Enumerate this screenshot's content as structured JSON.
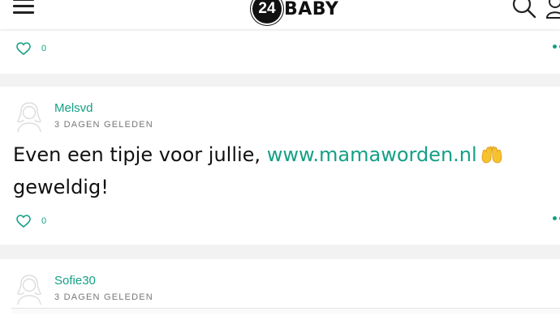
{
  "header": {
    "logo_number": "24",
    "logo_text": "BABY"
  },
  "posts": [
    {
      "likes": "0"
    },
    {
      "author": "Melsvd",
      "time": "3 DAGEN GELEDEN",
      "text_before": "Even een tipje voor jullie,",
      "link": "www.mamaworden.nl",
      "emoji": "raising-hands-emoji",
      "text_after": "geweldig!",
      "likes": "0"
    },
    {
      "author": "Sofie30",
      "time": "3 DAGEN GELEDEN"
    }
  ],
  "colors": {
    "accent": "#14a085",
    "background": "#f2f2f2",
    "text": "#111111",
    "muted": "#777777"
  },
  "icons": [
    "menu-icon",
    "search-icon",
    "user-icon",
    "heart-icon",
    "more-options-icon",
    "avatar-icon"
  ]
}
